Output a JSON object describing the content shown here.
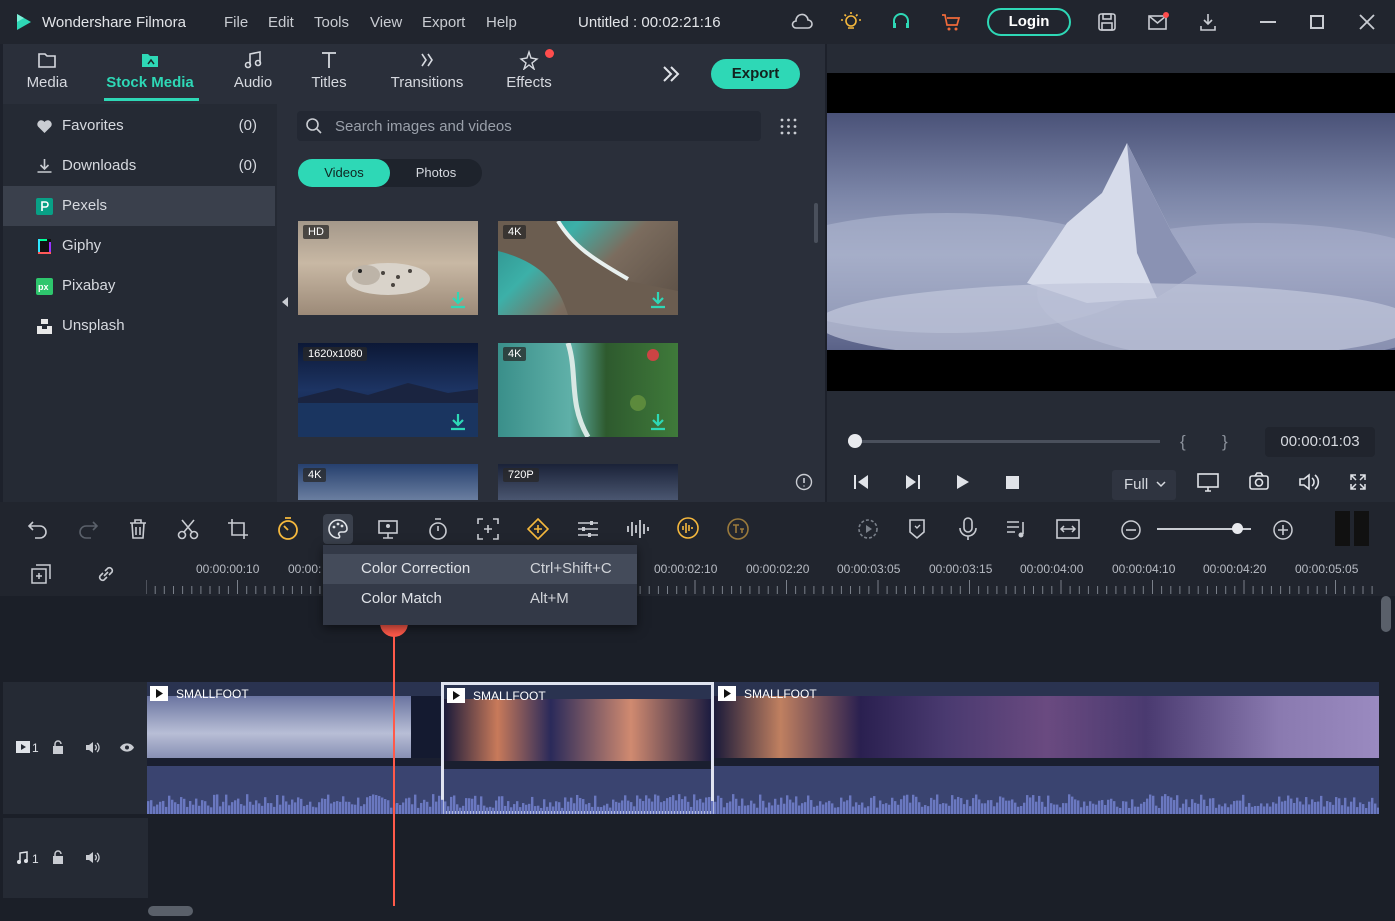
{
  "app": {
    "name": "Wondershare Filmora",
    "project_title": "Untitled : 00:02:21:16"
  },
  "menu": [
    "File",
    "Edit",
    "Tools",
    "View",
    "Export",
    "Help"
  ],
  "login_label": "Login",
  "tabs": [
    {
      "label": "Media",
      "icon": "folder-icon"
    },
    {
      "label": "Stock Media",
      "icon": "stock-media-icon"
    },
    {
      "label": "Audio",
      "icon": "music-note-icon"
    },
    {
      "label": "Titles",
      "icon": "titles-icon"
    },
    {
      "label": "Transitions",
      "icon": "transitions-icon"
    },
    {
      "label": "Effects",
      "icon": "effects-icon"
    }
  ],
  "active_tab": "Stock Media",
  "export_label": "Export",
  "sidebar": {
    "items": [
      {
        "label": "Favorites",
        "count": "(0)",
        "icon": "heart-icon"
      },
      {
        "label": "Downloads",
        "count": "(0)",
        "icon": "download-icon"
      },
      {
        "label": "Pexels",
        "count": "",
        "icon": "pexels-icon"
      },
      {
        "label": "Giphy",
        "count": "",
        "icon": "giphy-icon"
      },
      {
        "label": "Pixabay",
        "count": "",
        "icon": "pixabay-icon"
      },
      {
        "label": "Unsplash",
        "count": "",
        "icon": "unsplash-icon"
      }
    ],
    "selected": "Pexels"
  },
  "search": {
    "placeholder": "Search images and videos"
  },
  "segments": {
    "videos": "Videos",
    "photos": "Photos"
  },
  "thumbnails": [
    {
      "badge": "HD"
    },
    {
      "badge": "4K"
    },
    {
      "badge": "1620x1080"
    },
    {
      "badge": "4K"
    },
    {
      "badge": "4K"
    },
    {
      "badge": "720P"
    }
  ],
  "preview": {
    "timecode": "00:00:01:03",
    "quality": "Full",
    "progress": 0.0
  },
  "timeline": {
    "ruler": [
      "00:00:00:10",
      "00:00:",
      "00:00:02:10",
      "00:00:02:20",
      "00:00:03:05",
      "00:00:03:15",
      "00:00:04:00",
      "00:00:04:10",
      "00:00:04:20",
      "00:00:05:05"
    ],
    "clips": [
      {
        "title": "SMALLFOOT"
      },
      {
        "title": "SMALLFOOT"
      },
      {
        "title": "SMALLFOOT"
      }
    ],
    "video_track": "1",
    "audio_track": "1"
  },
  "context_menu": [
    {
      "label": "Color Correction",
      "shortcut": "Ctrl+Shift+C"
    },
    {
      "label": "Color Match",
      "shortcut": "Alt+M"
    }
  ],
  "colors": {
    "accent": "#2ed8b6",
    "playhead": "#ff5a4a",
    "bg": "#1d212b"
  }
}
